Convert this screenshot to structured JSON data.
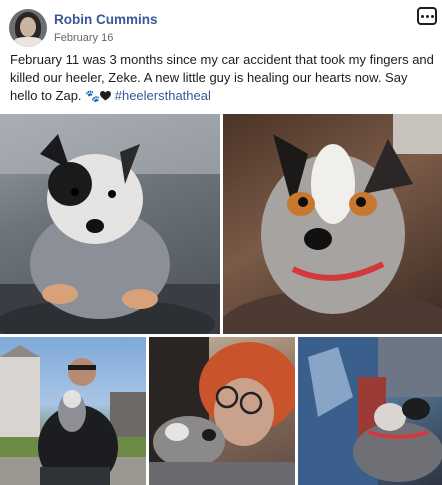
{
  "post": {
    "author": "Robin Cummins",
    "date": "February 16",
    "text_before_icons": "February 11 was 3 months since my car accident that took my fingers and killed our heeler, Zeke. A new little guy is healing our hearts now. Say hello to Zap. ",
    "paw_icon_glyph": "🐾",
    "hashtag": "#heelersthatheal"
  },
  "icons": {
    "avatar": "avatar",
    "more": "more-options-icon",
    "paw": "paw-prints-icon",
    "heart": "black-heart-icon"
  },
  "colors": {
    "link": "#385898",
    "text": "#1c1e21",
    "meta": "#616770"
  }
}
